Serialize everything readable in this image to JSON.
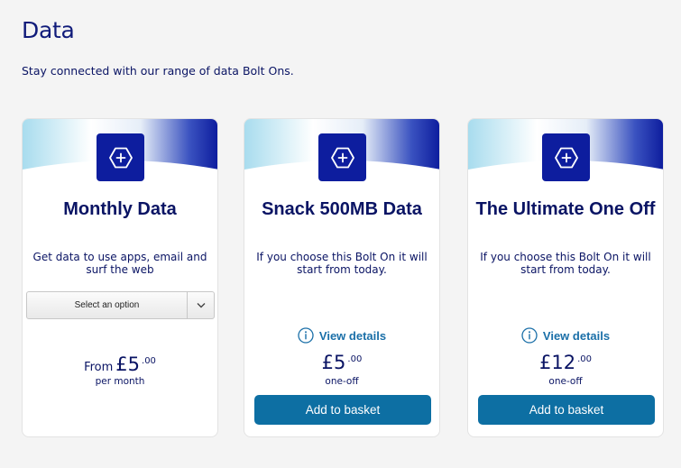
{
  "page": {
    "title": "Data",
    "subtitle": "Stay connected with our range of data Bolt Ons."
  },
  "colors": {
    "navy_text": "#0a1464",
    "icon_tile": "#0d1d9e",
    "button": "#0d6fa3",
    "link": "#1a6fa8",
    "header_gradient_light": "#a8dcee",
    "header_gradient_dark": "#0b1a9c"
  },
  "icons": {
    "bolt_on": "hexagon-plus-icon",
    "info": "info-circle-icon",
    "dropdown": "chevron-down-icon"
  },
  "cards": [
    {
      "title": "Monthly Data",
      "description": "Get data to use apps, email and surf the web",
      "select": {
        "selected": "Select an option"
      },
      "price": {
        "prefix": "From",
        "major": "£5",
        "minor": ".00"
      },
      "period": "per month"
    },
    {
      "title": "Snack 500MB Data",
      "description": "If you choose this Bolt On it will start from today.",
      "details_label": "View details",
      "price": {
        "major": "£5",
        "minor": ".00"
      },
      "period": "one-off",
      "button_label": "Add to basket"
    },
    {
      "title": "The Ultimate One Off",
      "description": "If you choose this Bolt On it will start from today.",
      "details_label": "View details",
      "price": {
        "major": "£12",
        "minor": ".00"
      },
      "period": "one-off",
      "button_label": "Add to basket"
    }
  ]
}
